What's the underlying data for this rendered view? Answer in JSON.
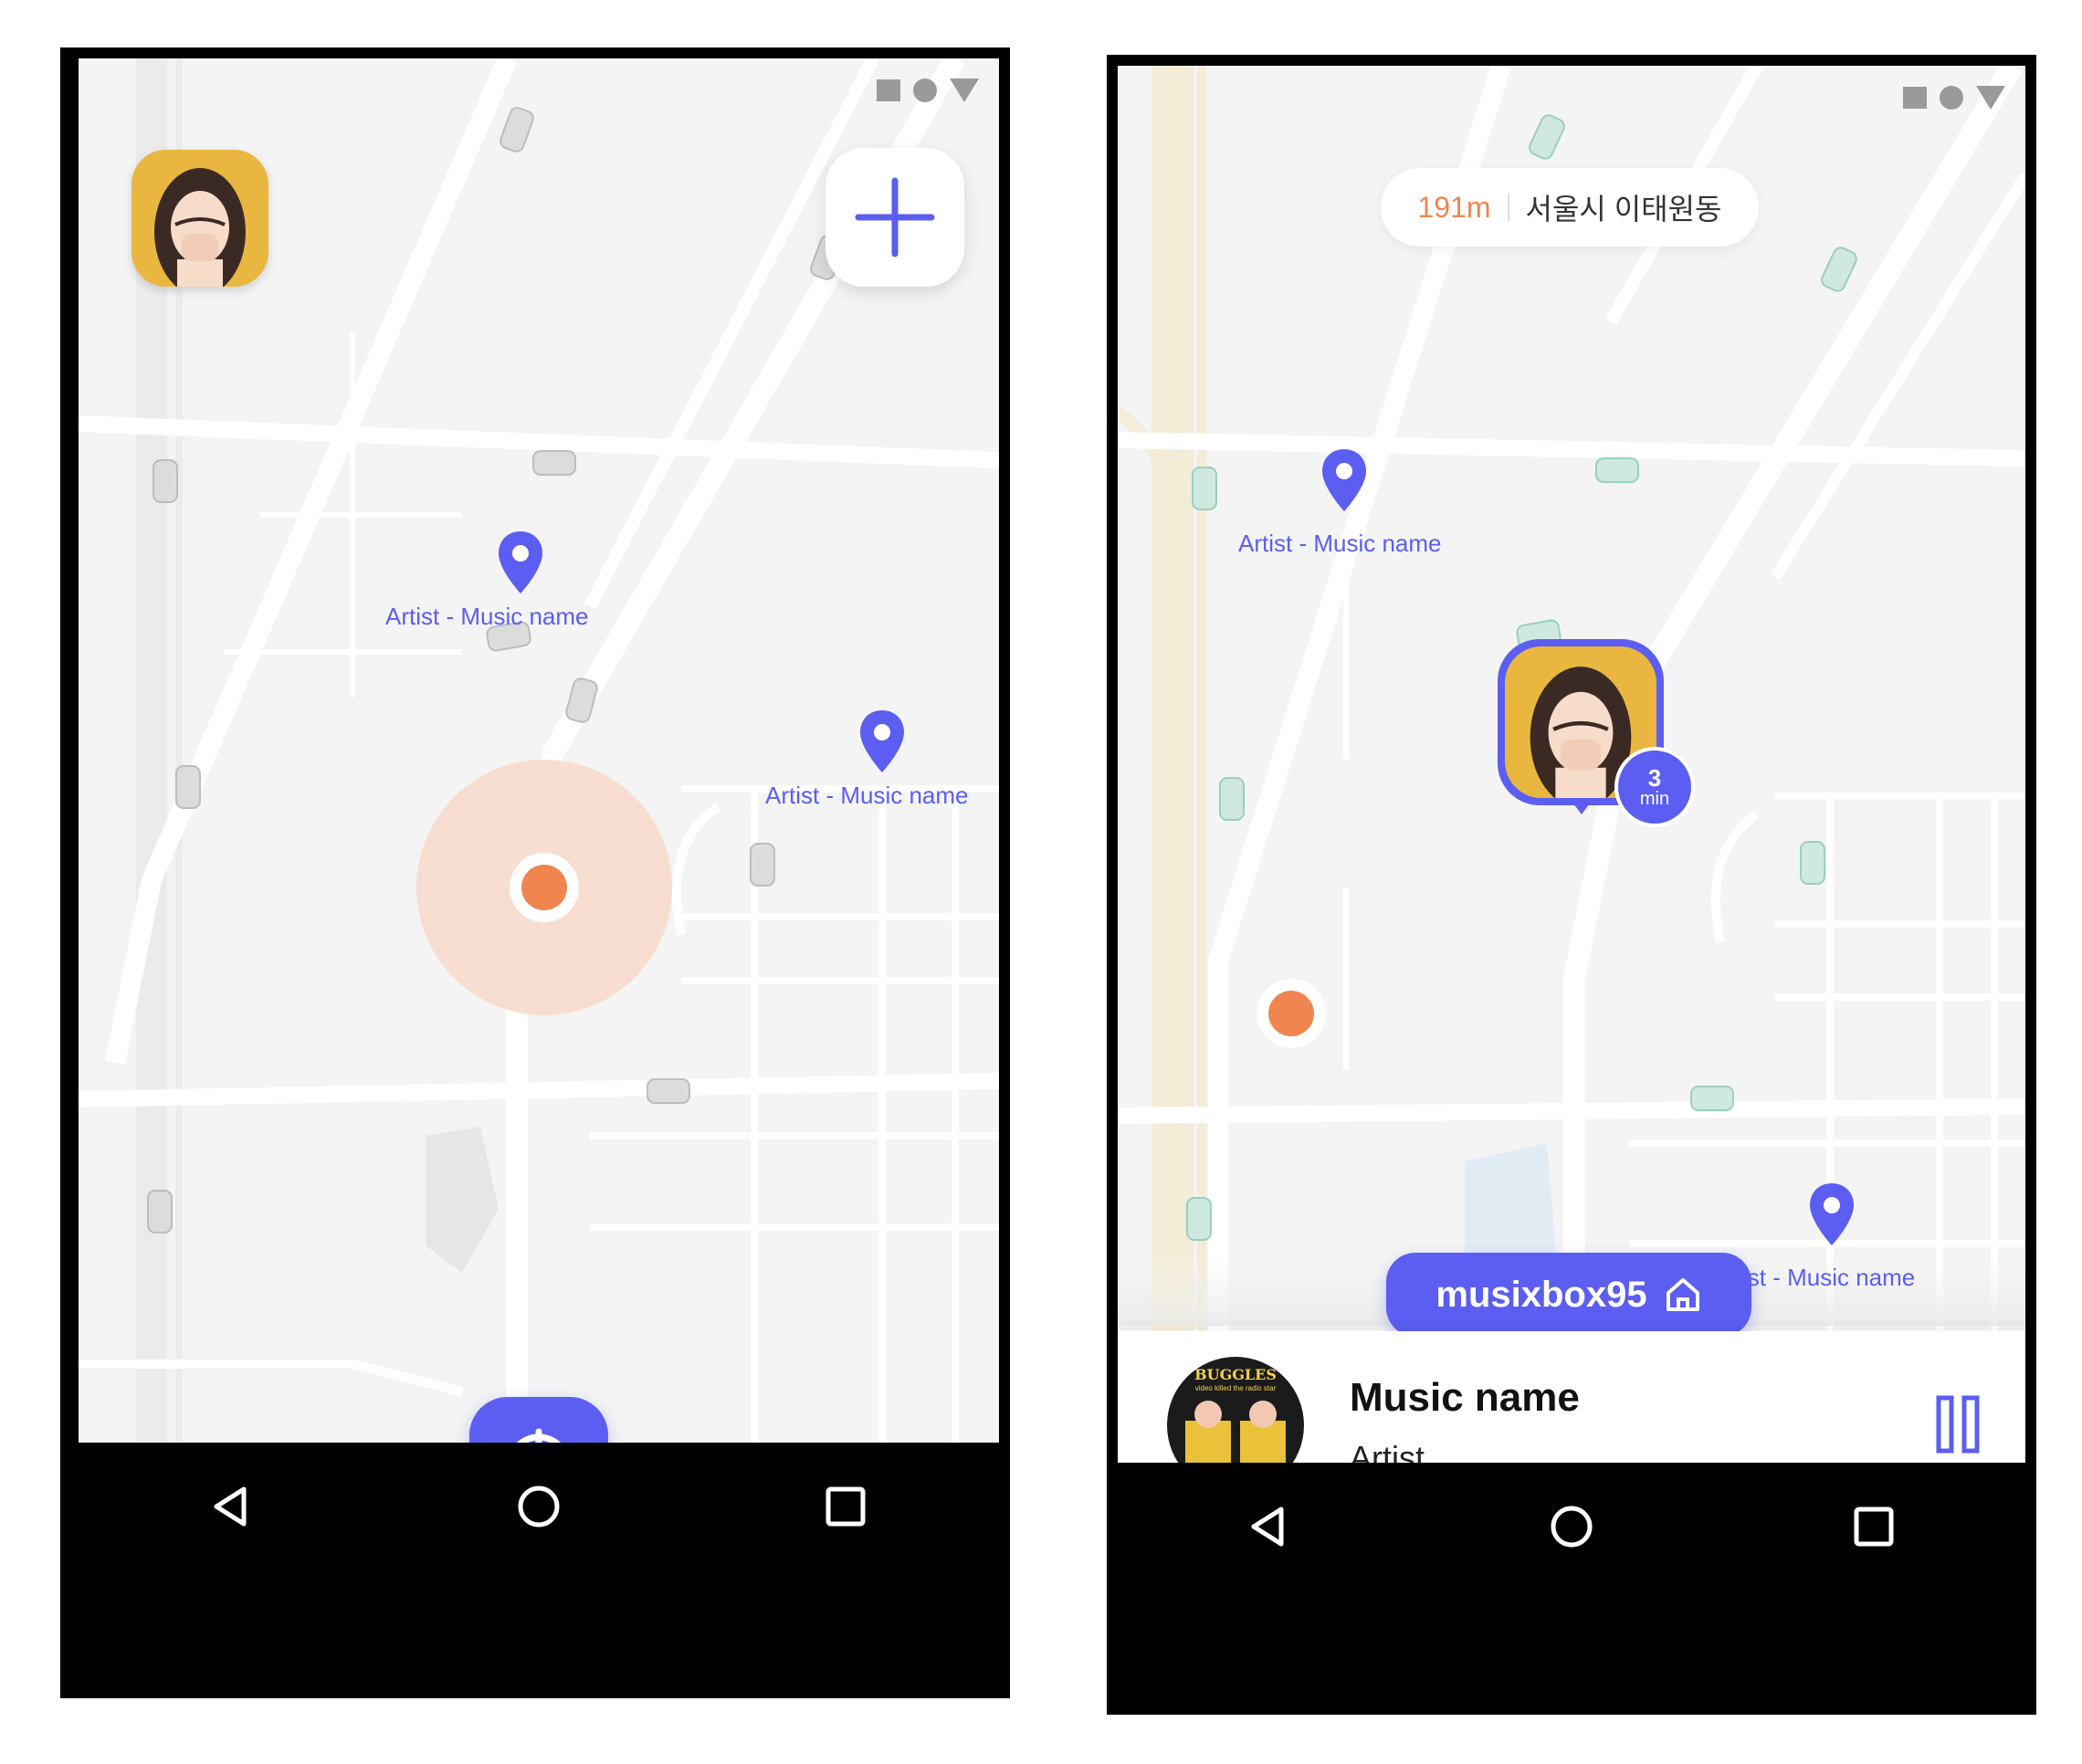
{
  "screens": [
    {
      "id": "left",
      "pins": [
        {
          "label": "Artist - Music name"
        },
        {
          "label": "Artist - Music name"
        }
      ],
      "nav": {
        "back": "back-icon",
        "home": "home-icon",
        "recents": "recents-icon"
      }
    },
    {
      "id": "right",
      "distance_chip": {
        "distance": "191m",
        "address": "서울시 이태원동"
      },
      "pins": [
        {
          "label": "Artist - Music name"
        },
        {
          "label": "ist - Music name"
        }
      ],
      "friend_marker": {
        "eta_value": "3",
        "eta_unit": "min"
      },
      "user_chip": {
        "username": "musixbox95",
        "icon": "home-icon"
      },
      "now_playing": {
        "title": "Music name",
        "artist": "Artist",
        "album_art_text": "BUGGLES",
        "album_art_subtitle": "video killed the radio star",
        "control": "pause-icon"
      },
      "nav": {
        "back": "back-icon",
        "home": "home-icon",
        "recents": "recents-icon"
      }
    }
  ],
  "colors": {
    "accent": "#5b5ef0",
    "orange": "#f0854f",
    "orange_halo": "#f8d9c9",
    "map_bg": "#f4f4f4",
    "road": "#ffffff",
    "avatar_bg": "#e9b73f"
  }
}
